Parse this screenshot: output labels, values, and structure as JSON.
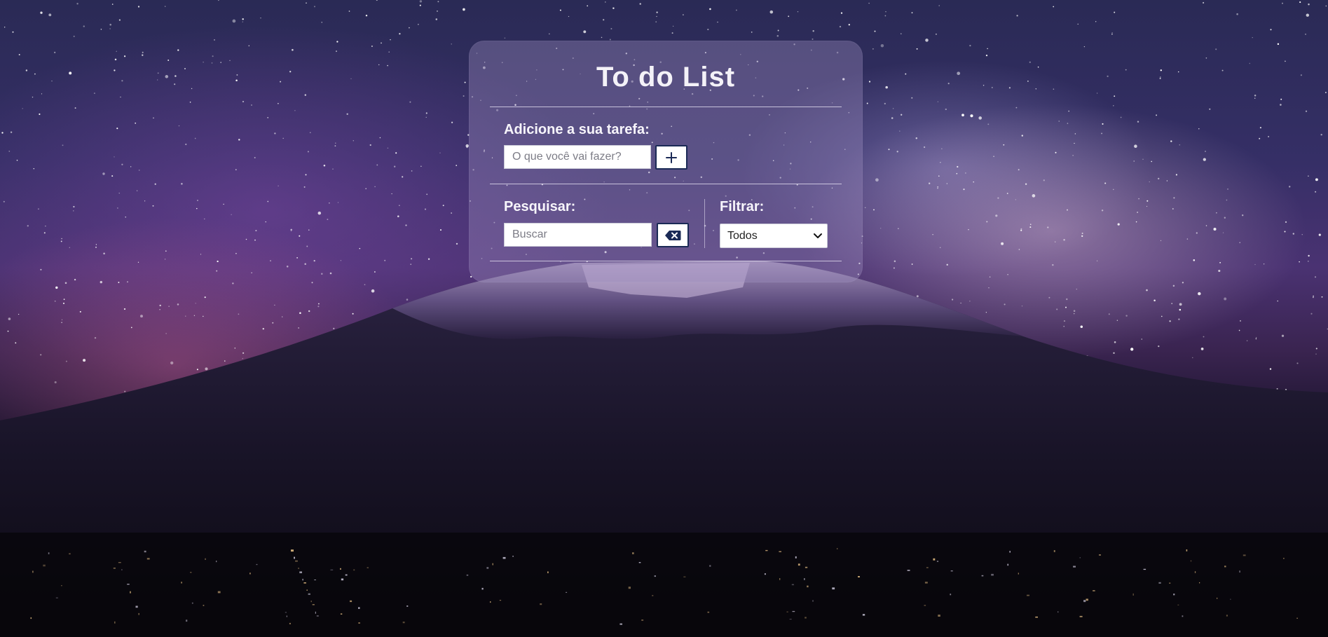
{
  "app": {
    "title": "To do List"
  },
  "add_task": {
    "label": "Adicione a sua tarefa:",
    "input_value": "",
    "input_placeholder": "O que você vai fazer?",
    "button_icon": "plus-icon"
  },
  "search": {
    "label": "Pesquisar:",
    "input_value": "",
    "input_placeholder": "Buscar",
    "button_icon": "backspace-icon"
  },
  "filter": {
    "label": "Filtrar:",
    "selected": "Todos"
  },
  "colors": {
    "accent": "#1b2a56",
    "title_text": "#f4f2f8",
    "card_bg": "rgba(155,140,190,0.38)"
  }
}
